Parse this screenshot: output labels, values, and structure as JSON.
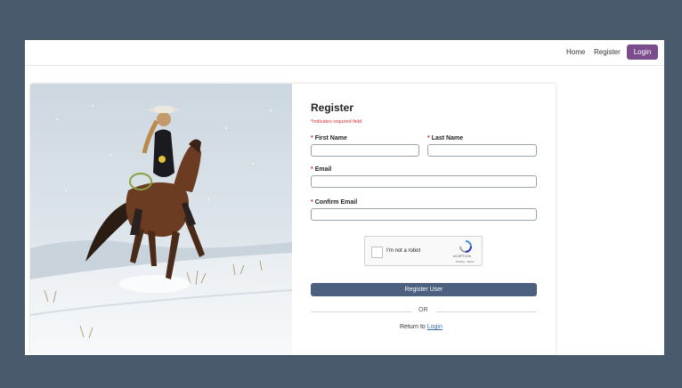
{
  "nav": {
    "home": "Home",
    "register": "Register",
    "login": "Login"
  },
  "form": {
    "title": "Register",
    "required_note": "*indicates required field",
    "required_star": "*",
    "first_name_label": "First Name",
    "last_name_label": "Last Name",
    "email_label": "Email",
    "confirm_email_label": "Confirm Email",
    "first_name_value": "",
    "last_name_value": "",
    "email_value": "",
    "confirm_email_value": "",
    "captcha_text": "I'm not a robot",
    "captcha_brand": "reCAPTCHA",
    "captcha_terms": "Privacy - Terms",
    "submit_label": "Register User",
    "or_text": "OR",
    "return_prefix": "Return to",
    "return_link": "Login"
  },
  "colors": {
    "background": "#4a5a6d",
    "login_button": "#7a4c8c",
    "submit_button": "#4c6080",
    "required": "#d23030"
  },
  "icons": {
    "captcha": "recaptcha-icon"
  }
}
